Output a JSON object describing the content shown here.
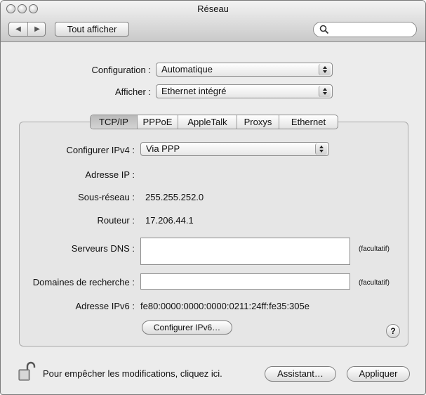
{
  "window": {
    "title": "Réseau"
  },
  "toolbar": {
    "back_icon": "◀",
    "forward_icon": "▶",
    "show_all_label": "Tout afficher",
    "search_placeholder": ""
  },
  "form": {
    "configuration_label": "Configuration :",
    "configuration_value": "Automatique",
    "show_label": "Afficher :",
    "show_value": "Ethernet intégré"
  },
  "tabs": [
    "TCP/IP",
    "PPPoE",
    "AppleTalk",
    "Proxys",
    "Ethernet"
  ],
  "active_tab": "TCP/IP",
  "tcpip": {
    "configure_ipv4_label": "Configurer IPv4 :",
    "configure_ipv4_value": "Via PPP",
    "ip_label": "Adresse IP :",
    "ip_value": "",
    "subnet_label": "Sous-réseau :",
    "subnet_value": "255.255.252.0",
    "router_label": "Routeur :",
    "router_value": "17.206.44.1",
    "dns_label": "Serveurs DNS :",
    "dns_value": "",
    "dns_hint": "(facultatif)",
    "search_domains_label": "Domaines de recherche :",
    "search_domains_value": "",
    "search_domains_hint": "(facultatif)",
    "ipv6_label": "Adresse IPv6 :",
    "ipv6_value": "fe80:0000:0000:0000:0211:24ff:fe35:305e",
    "configure_ipv6_button": "Configurer IPv6…",
    "help_label": "?"
  },
  "footer": {
    "lock_text": "Pour empêcher les modifications, cliquez ici.",
    "assistant_button": "Assistant…",
    "apply_button": "Appliquer"
  }
}
